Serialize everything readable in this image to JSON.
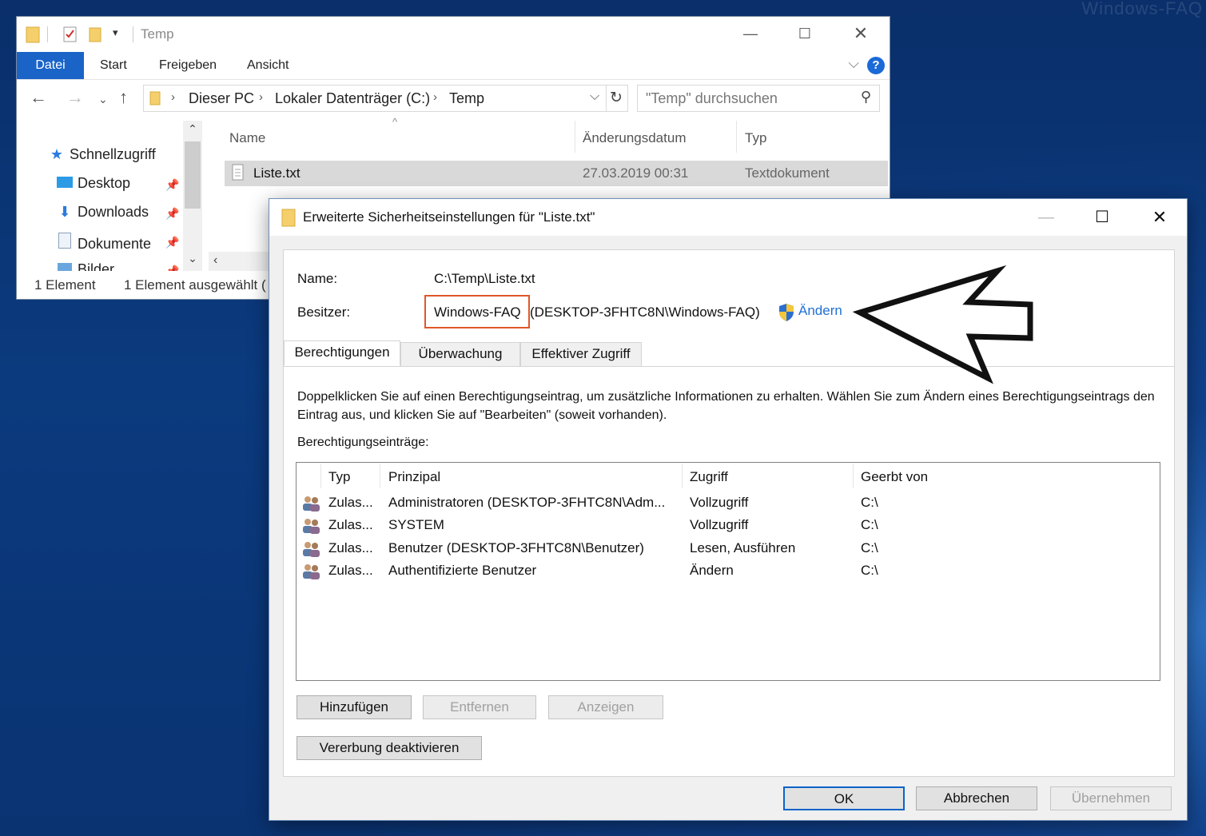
{
  "watermark": "Windows-FAQ",
  "explorer": {
    "title": "Temp",
    "ribbon_tabs": [
      "Datei",
      "Start",
      "Freigeben",
      "Ansicht"
    ],
    "help_label": "?",
    "address": {
      "crumbs": [
        "Dieser PC",
        "Lokaler Datenträger (C:)",
        "Temp"
      ]
    },
    "search_placeholder": "\"Temp\" durchsuchen",
    "sidebar": {
      "quick_access": "Schnellzugriff",
      "items": [
        {
          "label": "Desktop",
          "icon": "desktop-icon"
        },
        {
          "label": "Downloads",
          "icon": "download-icon"
        },
        {
          "label": "Dokumente",
          "icon": "document-icon"
        },
        {
          "label": "Bilder",
          "icon": "pictures-icon"
        }
      ]
    },
    "columns": {
      "name": "Name",
      "modified": "Änderungsdatum",
      "type": "Typ"
    },
    "files": [
      {
        "name": "Liste.txt",
        "modified": "27.03.2019 00:31",
        "type": "Textdokument"
      }
    ],
    "status": {
      "count": "1 Element",
      "selected": "1 Element ausgewählt ("
    }
  },
  "dialog": {
    "title": "Erweiterte Sicherheitseinstellungen für \"Liste.txt\"",
    "name_label": "Name:",
    "name_value": "C:\\Temp\\Liste.txt",
    "owner_label": "Besitzer:",
    "owner_name": "Windows-FAQ",
    "owner_detail": "(DESKTOP-3FHTC8N\\Windows-FAQ)",
    "change_link": "Ändern",
    "tabs": [
      "Berechtigungen",
      "Überwachung",
      "Effektiver Zugriff"
    ],
    "description": "Doppelklicken Sie auf einen Berechtigungseintrag, um zusätzliche Informationen zu erhalten. Wählen Sie zum Ändern eines Berechtigungseintrags den Eintrag aus, und klicken Sie auf \"Bearbeiten\" (soweit vorhanden).",
    "entries_label": "Berechtigungseinträge:",
    "table": {
      "headers": {
        "type": "Typ",
        "principal": "Prinzipal",
        "access": "Zugriff",
        "inherited": "Geerbt von"
      },
      "rows": [
        {
          "type": "Zulas...",
          "principal": "Administratoren (DESKTOP-3FHTC8N\\Adm...",
          "access": "Vollzugriff",
          "inherited": "C:\\"
        },
        {
          "type": "Zulas...",
          "principal": "SYSTEM",
          "access": "Vollzugriff",
          "inherited": "C:\\"
        },
        {
          "type": "Zulas...",
          "principal": "Benutzer (DESKTOP-3FHTC8N\\Benutzer)",
          "access": "Lesen, Ausführen",
          "inherited": "C:\\"
        },
        {
          "type": "Zulas...",
          "principal": "Authentifizierte Benutzer",
          "access": "Ändern",
          "inherited": "C:\\"
        }
      ]
    },
    "buttons": {
      "add": "Hinzufügen",
      "remove": "Entfernen",
      "view": "Anzeigen",
      "disable_inheritance": "Vererbung deaktivieren",
      "ok": "OK",
      "cancel": "Abbrechen",
      "apply": "Übernehmen"
    }
  },
  "colors": {
    "accent": "#1a64c8",
    "highlight": "#e0572a",
    "link": "#1f6fd6"
  }
}
